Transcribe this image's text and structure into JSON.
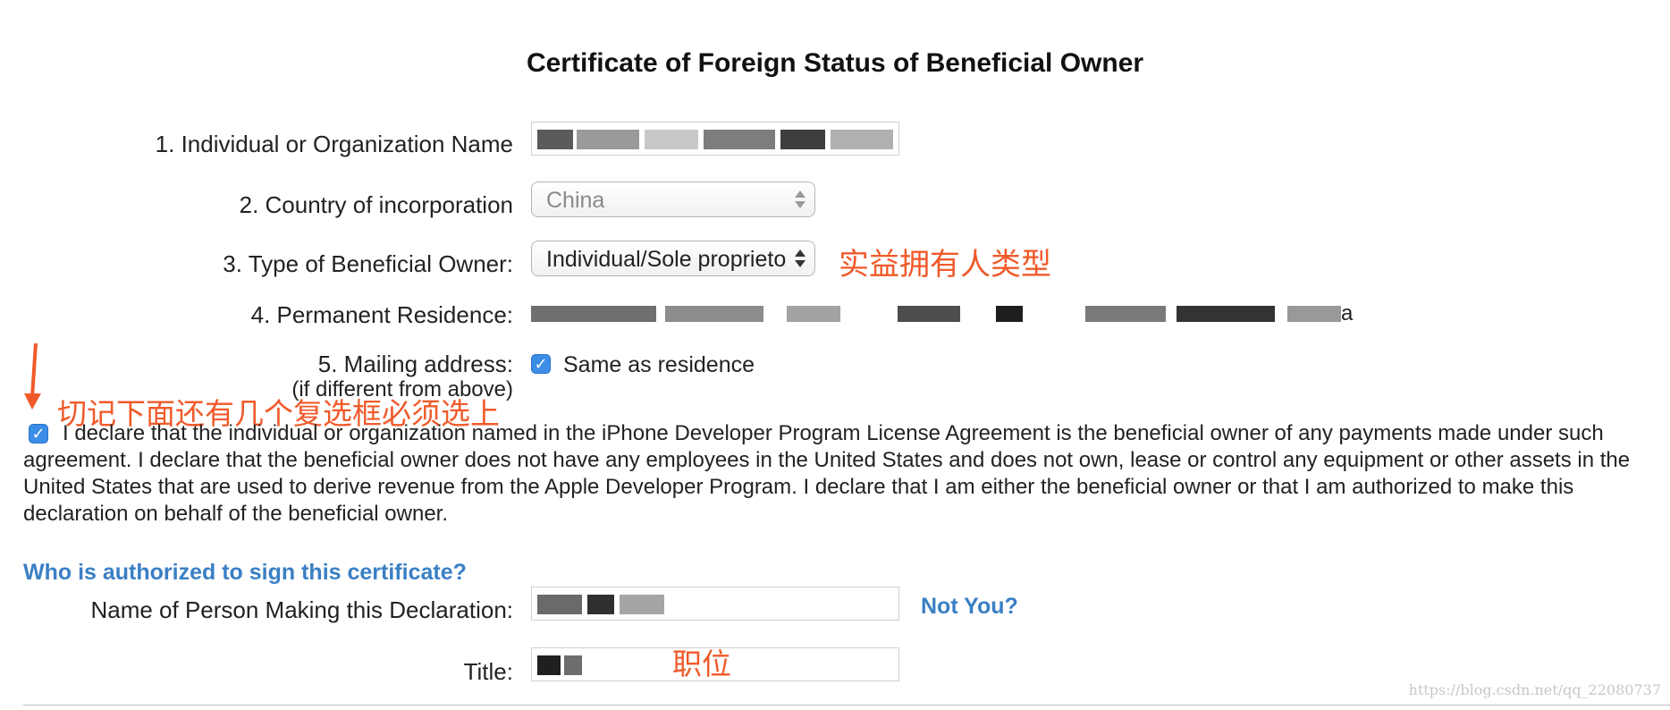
{
  "page": {
    "title": "Certificate of Foreign Status of Beneficial Owner"
  },
  "form": {
    "org_name": {
      "label": "1. Individual or Organization Name"
    },
    "country": {
      "label": "2. Country of incorporation",
      "value": "China"
    },
    "owner_type": {
      "label": "3. Type of Beneficial Owner:",
      "value": "Individual/Sole proprieto"
    },
    "residence": {
      "label": "4. Permanent Residence:",
      "visible_text_end": "a"
    },
    "mailing": {
      "label": "5. Mailing address:",
      "sublabel": "(if different from above)",
      "checkbox_label": "Same as residence",
      "checked": true
    },
    "declaration": {
      "checked": true,
      "text": "I declare that the individual or organization named in the iPhone Developer Program License Agreement is the beneficial owner of any payments made under such agreement. I declare that the beneficial owner does not have any employees in the United States and does not own, lease or control any equipment or other assets in the United States that are used to derive revenue from the Apple Developer Program. I declare that I am either the beneficial owner or that I am authorized to make this declaration on behalf of the beneficial owner."
    },
    "signer": {
      "heading": "Who is authorized to sign this certificate?",
      "name_label": "Name of Person Making this Declaration:",
      "not_you": "Not You?",
      "title_label": "Title:"
    }
  },
  "annotations": {
    "owner_type_note": "实益拥有人类型",
    "checkbox_note": "切记下面还有几个复选框必须选上",
    "title_note": "职位"
  },
  "watermark": "https://blog.csdn.net/qq_22080737",
  "colors": {
    "accent_blue": "#3a7fc4",
    "annotation_red": "#f05a2a",
    "checkbox_blue": "#3b8de6"
  }
}
